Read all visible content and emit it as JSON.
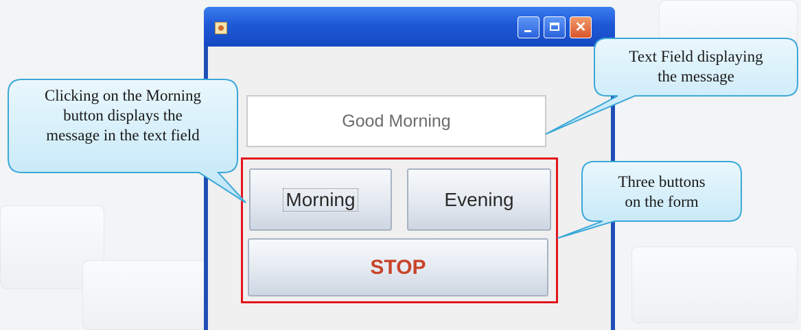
{
  "window": {
    "title": "",
    "controls": {
      "minimize": "minimize-icon",
      "maximize": "maximize-icon",
      "close": "close-icon"
    }
  },
  "form": {
    "text_field_value": "Good Morning",
    "morning_label": "Morning",
    "evening_label": "Evening",
    "stop_label": "STOP"
  },
  "callouts": {
    "left_line1": "Clicking on the Morning",
    "left_line2": "button displays the",
    "left_line3": "message in the text field",
    "top_right_line1": "Text Field displaying",
    "top_right_line2": "the message",
    "bottom_right_line1": "Three buttons",
    "bottom_right_line2": "on the form"
  },
  "colors": {
    "highlight_border": "#e3141a",
    "stop_text": "#c8442a",
    "callout_border": "#3aa7d8",
    "titlebar": "#1e58d6"
  }
}
